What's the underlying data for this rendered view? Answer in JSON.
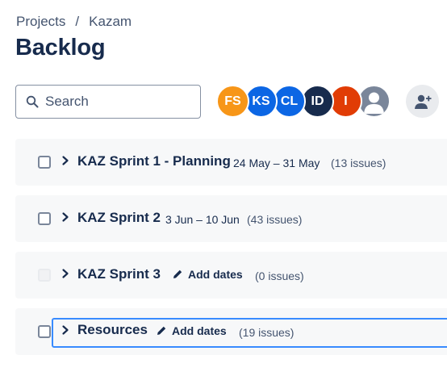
{
  "breadcrumb": {
    "projects": "Projects",
    "separator": "/",
    "project": "Kazam"
  },
  "page": {
    "title": "Backlog"
  },
  "search": {
    "placeholder": "Search"
  },
  "avatars": [
    {
      "initials": "FS",
      "color": "#f79618"
    },
    {
      "initials": "KS",
      "color": "#0c66e4"
    },
    {
      "initials": "CL",
      "color": "#0c66e4"
    },
    {
      "initials": "ID",
      "color": "#172b4d"
    },
    {
      "initials": "I",
      "color": "#e13c05"
    },
    {
      "initials": "",
      "color": "#7a869a",
      "icon": "person-icon"
    }
  ],
  "add_people_icon": "add-person-icon",
  "sprints": [
    {
      "name": "KAZ Sprint 1 - Planning",
      "dates": "24 May – 31 May",
      "count": "(13 issues)"
    },
    {
      "name": "KAZ Sprint 2",
      "dates": "3 Jun – 10 Jun",
      "count": "(43 issues)"
    },
    {
      "name": "KAZ Sprint 3",
      "add_dates": "Add dates",
      "count": "(0 issues)"
    },
    {
      "name": "Resources",
      "add_dates": "Add dates",
      "count": "(19 issues)"
    }
  ]
}
